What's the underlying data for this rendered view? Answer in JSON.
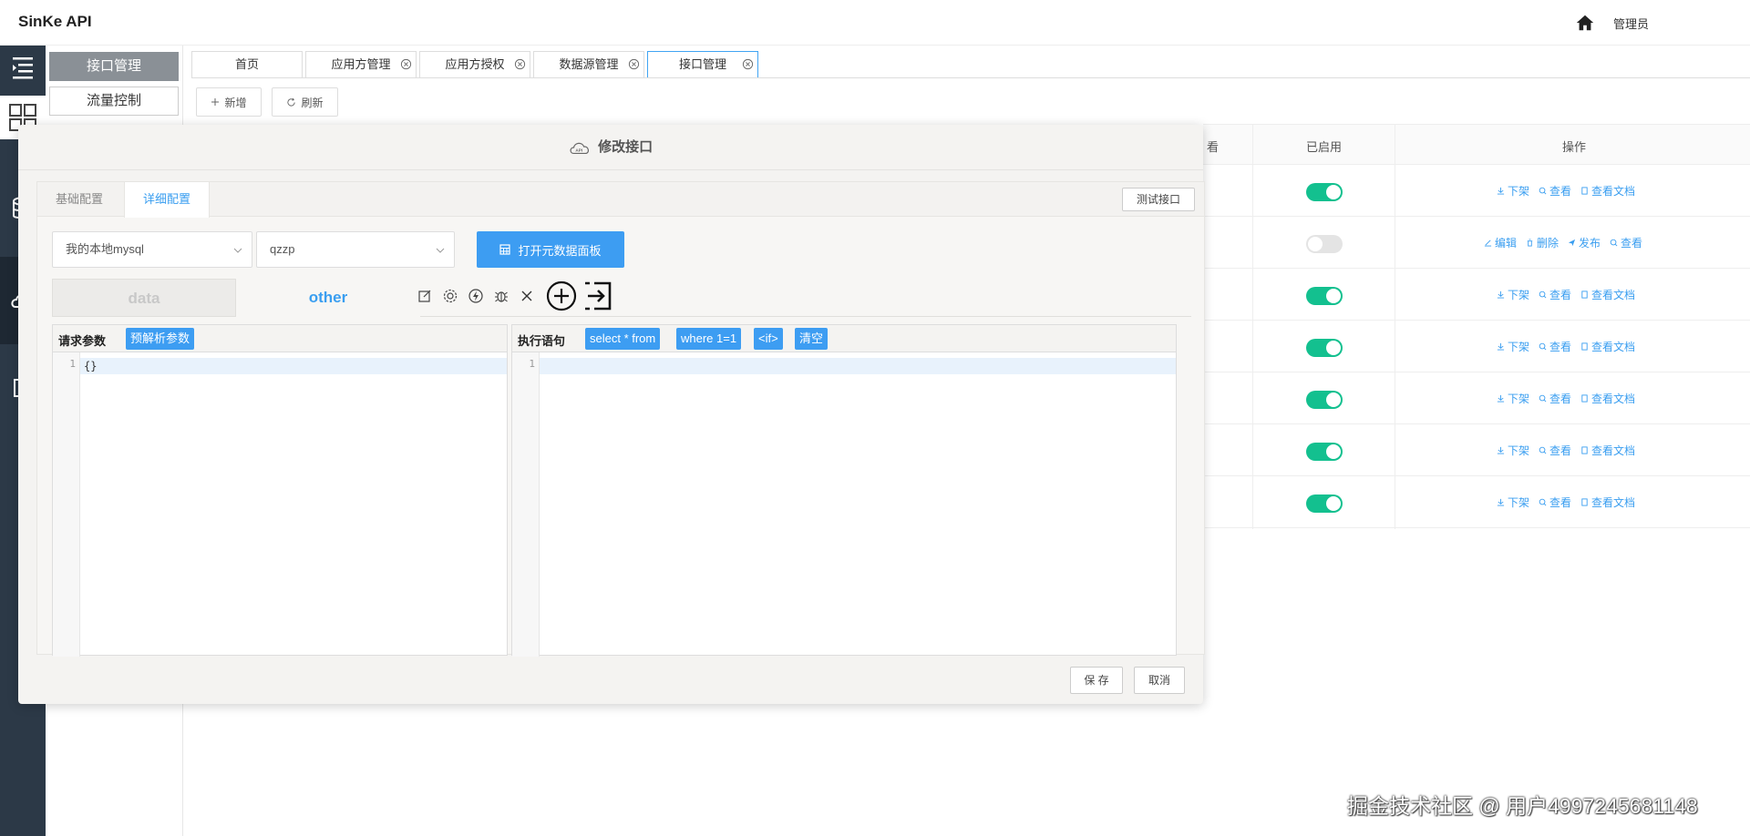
{
  "app": {
    "title": "SinKe API",
    "user": "管理员"
  },
  "submenu": {
    "items": [
      {
        "label": "接口管理",
        "active": true
      },
      {
        "label": "流量控制",
        "active": false
      }
    ]
  },
  "tabs": [
    {
      "label": "首页",
      "closable": false
    },
    {
      "label": "应用方管理",
      "closable": true
    },
    {
      "label": "应用方授权",
      "closable": true
    },
    {
      "label": "数据源管理",
      "closable": true
    },
    {
      "label": "接口管理",
      "closable": true,
      "active": true
    }
  ],
  "toolbar": {
    "add_label": "新增",
    "refresh_label": "刷新"
  },
  "table": {
    "headers": {
      "partial": "看",
      "enabled": "已启用",
      "actions": "操作"
    },
    "rows": [
      {
        "enabled": true,
        "actions": [
          "下架",
          "查看",
          "查看文档"
        ]
      },
      {
        "enabled": false,
        "actions": [
          "编辑",
          "删除",
          "发布",
          "查看"
        ]
      },
      {
        "enabled": true,
        "actions": [
          "下架",
          "查看",
          "查看文档"
        ]
      },
      {
        "enabled": true,
        "actions": [
          "下架",
          "查看",
          "查看文档"
        ]
      },
      {
        "enabled": true,
        "actions": [
          "下架",
          "查看",
          "查看文档"
        ]
      },
      {
        "enabled": true,
        "actions": [
          "下架",
          "查看",
          "查看文档"
        ]
      },
      {
        "enabled": true,
        "actions": [
          "下架",
          "查看",
          "查看文档"
        ]
      }
    ]
  },
  "modal": {
    "title": "修改接口",
    "tabs": {
      "basic": "基础配置",
      "detail": "详细配置"
    },
    "test_button": "测试接口",
    "datasource_select": "我的本地mysql",
    "schema_select": "qzzp",
    "meta_button": "打开元数据面板",
    "subtabs": {
      "data": "data",
      "other": "other"
    },
    "params_panel": {
      "label": "请求参数",
      "parse_button": "预解析参数",
      "line_no": "1",
      "code": "{}"
    },
    "sql_panel": {
      "label": "执行语句",
      "chips": [
        "select * from",
        "where 1=1",
        "<if>",
        "清空"
      ],
      "line_no": "1"
    },
    "save_button": "保 存",
    "cancel_button": "取消"
  },
  "watermark": "掘金技术社区 @ 用户4997245681148",
  "colors": {
    "accent": "#3d9df2",
    "toggle_on": "#13c08f",
    "rail": "#2c3947"
  }
}
